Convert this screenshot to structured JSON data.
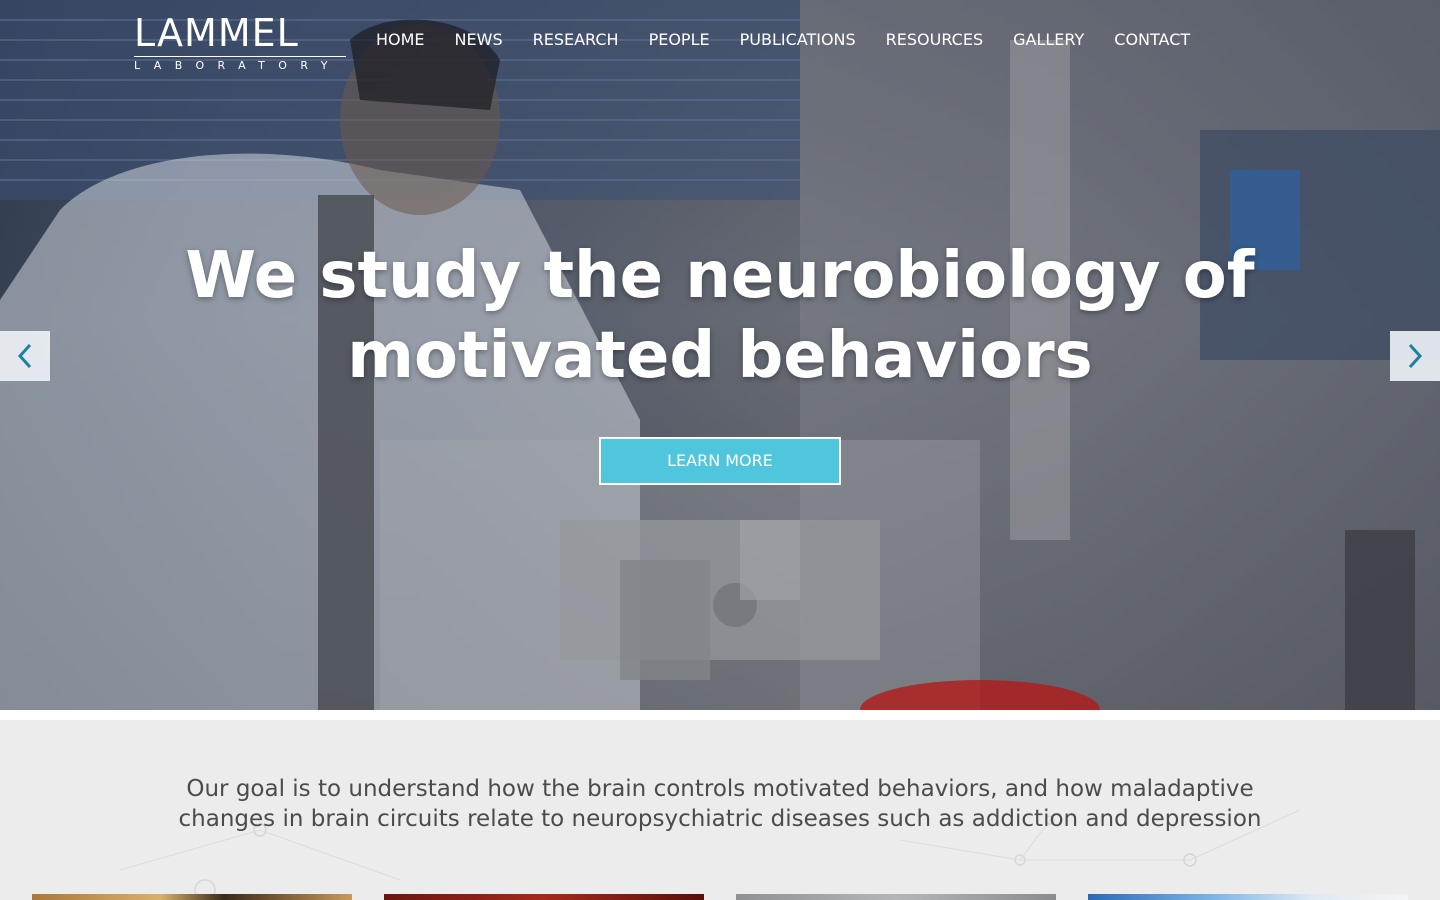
{
  "brand": {
    "name": "LAMMEL",
    "subtitle": "LABORATORY"
  },
  "nav": {
    "items": [
      {
        "label": "HOME"
      },
      {
        "label": "NEWS"
      },
      {
        "label": "RESEARCH"
      },
      {
        "label": "PEOPLE"
      },
      {
        "label": "PUBLICATIONS"
      },
      {
        "label": "RESOURCES"
      },
      {
        "label": "GALLERY"
      },
      {
        "label": "CONTACT"
      }
    ]
  },
  "hero": {
    "headline_line1": "We study the neurobiology of",
    "headline_line2": "motivated behaviors",
    "cta_label": "LEARN MORE",
    "prev_icon": "chevron-left-icon",
    "next_icon": "chevron-right-icon"
  },
  "intro": {
    "goal_line1": "Our goal is to understand how the brain controls motivated behaviors, and how maladaptive",
    "goal_line2": "changes in brain circuits relate to neuropsychiatric diseases such as addiction and depression"
  },
  "colors": {
    "accent": "#4fc6dc",
    "text_dark": "#4b4b4b",
    "section_bg": "#ececec"
  }
}
